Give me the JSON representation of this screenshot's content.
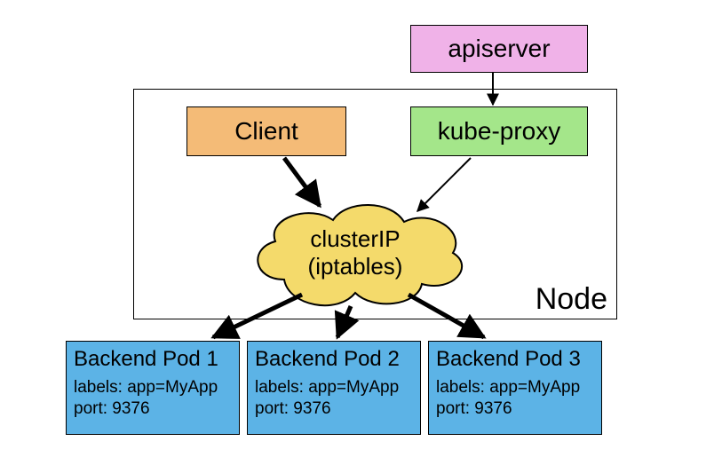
{
  "nodes": {
    "apiserver": "apiserver",
    "client": "Client",
    "kubeproxy": "kube-proxy",
    "node_label": "Node",
    "cloud_line1": "clusterIP",
    "cloud_line2": "(iptables)"
  },
  "pods": [
    {
      "title": "Backend Pod 1",
      "labels": "labels: app=MyApp",
      "port": "port: 9376"
    },
    {
      "title": "Backend Pod 2",
      "labels": "labels: app=MyApp",
      "port": "port: 9376"
    },
    {
      "title": "Backend Pod 3",
      "labels": "labels: app=MyApp",
      "port": "port: 9376"
    }
  ],
  "colors": {
    "apiserver": "#f0b2e8",
    "client": "#f4bb77",
    "kubeproxy": "#a4e68a",
    "cloud": "#f4da6b",
    "pod": "#5cb3e6"
  },
  "edges": [
    {
      "from": "apiserver",
      "to": "kubeproxy",
      "thick": false
    },
    {
      "from": "client",
      "to": "clusterIP",
      "thick": true
    },
    {
      "from": "kubeproxy",
      "to": "clusterIP",
      "thick": false
    },
    {
      "from": "clusterIP",
      "to": "pod1",
      "thick": true
    },
    {
      "from": "clusterIP",
      "to": "pod2",
      "thick": true
    },
    {
      "from": "clusterIP",
      "to": "pod3",
      "thick": true
    }
  ]
}
